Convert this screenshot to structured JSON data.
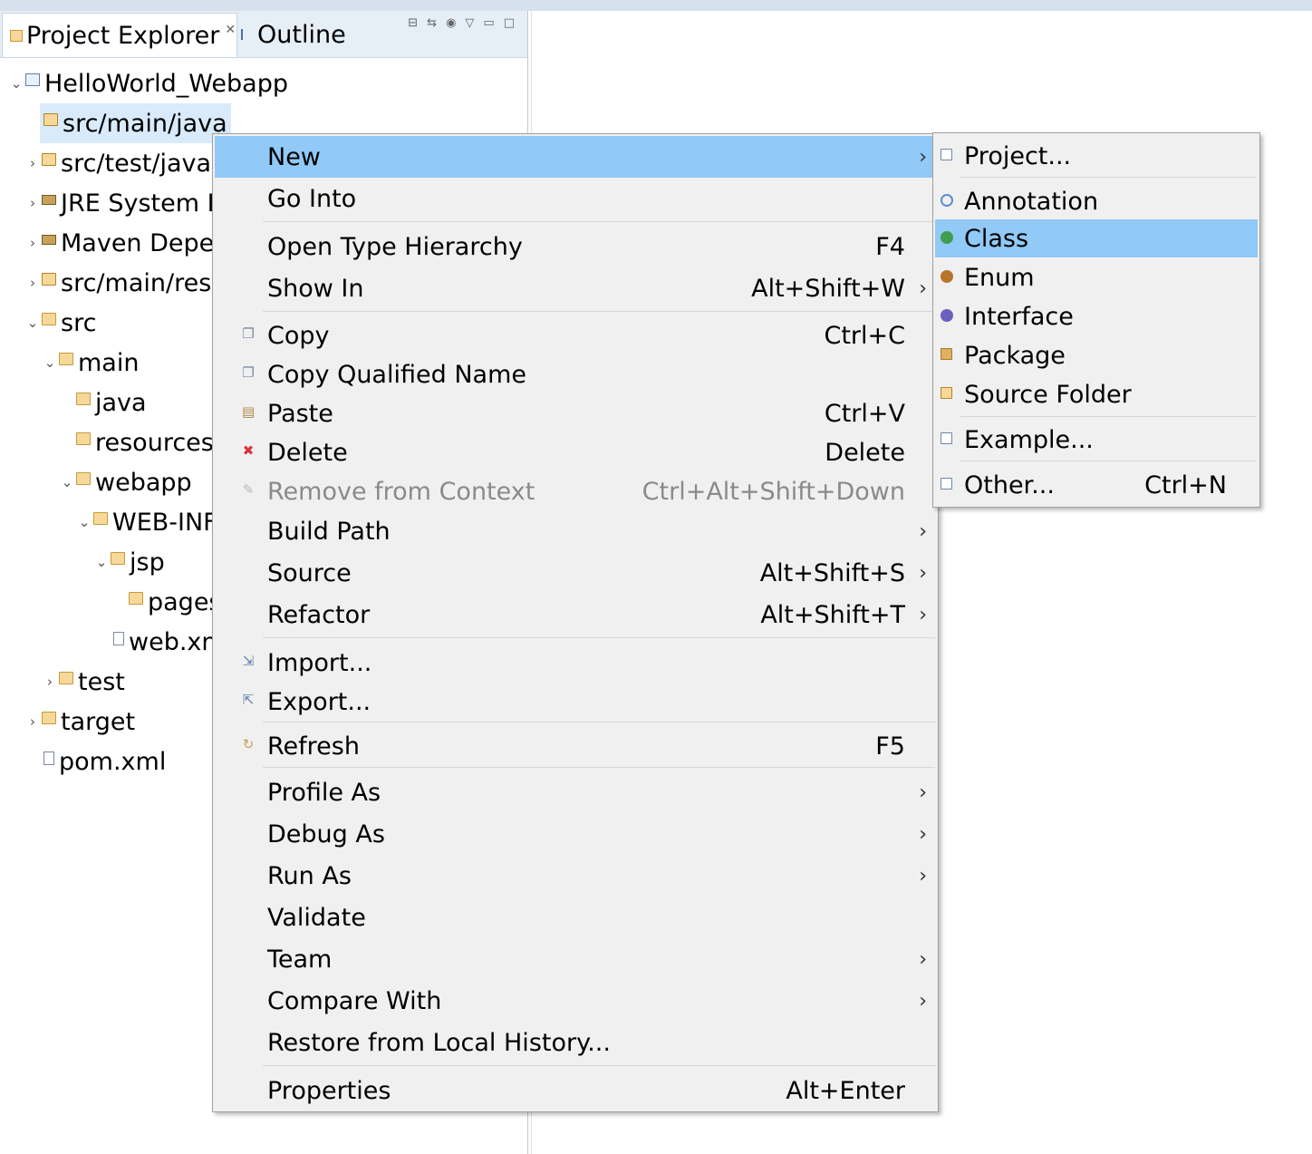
{
  "explorer": {
    "tabs": [
      {
        "label": "Project Explorer",
        "close": "✕"
      },
      {
        "label": "Outline"
      }
    ],
    "tree": [
      {
        "label": "HelloWorld_Webapp",
        "twisty": "⌄",
        "icon": "project-icon"
      },
      {
        "label": "src/main/java",
        "twisty": "",
        "icon": "source-folder-icon",
        "selected": true
      },
      {
        "label": "src/test/java",
        "twisty": "›",
        "icon": "source-folder-icon"
      },
      {
        "label": "JRE System L",
        "twisty": "›",
        "icon": "library-icon"
      },
      {
        "label": "Maven Depe",
        "twisty": "›",
        "icon": "library-icon"
      },
      {
        "label": "src/main/res",
        "twisty": "›",
        "icon": "source-folder-icon"
      },
      {
        "label": "src",
        "twisty": "⌄",
        "icon": "folder-icon"
      },
      {
        "label": "main",
        "twisty": "⌄",
        "icon": "folder-icon"
      },
      {
        "label": "java",
        "twisty": "",
        "icon": "folder-icon"
      },
      {
        "label": "resources",
        "twisty": "",
        "icon": "folder-icon"
      },
      {
        "label": "webapp",
        "twisty": "⌄",
        "icon": "folder-icon"
      },
      {
        "label": "WEB-INF",
        "twisty": "⌄",
        "icon": "folder-icon"
      },
      {
        "label": "jsp",
        "twisty": "⌄",
        "icon": "folder-icon"
      },
      {
        "label": "pages",
        "twisty": "",
        "icon": "folder-icon"
      },
      {
        "label": "web.xn",
        "twisty": "",
        "icon": "file-icon"
      },
      {
        "label": "test",
        "twisty": "›",
        "icon": "folder-icon"
      },
      {
        "label": "target",
        "twisty": "›",
        "icon": "folder-icon"
      },
      {
        "label": "pom.xml",
        "twisty": "",
        "icon": "file-icon"
      }
    ]
  },
  "context_menu": {
    "items": [
      {
        "label": "New",
        "shortcut": "",
        "submenu": true,
        "highlighted": true
      },
      {
        "label": "Go Into",
        "shortcut": ""
      },
      {
        "label": "Open Type Hierarchy",
        "shortcut": "F4"
      },
      {
        "label": "Show In",
        "shortcut": "Alt+Shift+W",
        "submenu": true
      },
      {
        "label": "Copy",
        "shortcut": "Ctrl+C",
        "icon": "copy-icon"
      },
      {
        "label": "Copy Qualified Name",
        "shortcut": "",
        "icon": "copy-qualified-icon"
      },
      {
        "label": "Paste",
        "shortcut": "Ctrl+V",
        "icon": "paste-icon"
      },
      {
        "label": "Delete",
        "shortcut": "Delete",
        "icon": "delete-icon"
      },
      {
        "label": "Remove from Context",
        "shortcut": "Ctrl+Alt+Shift+Down",
        "disabled": true,
        "icon": "remove-context-icon"
      },
      {
        "label": "Build Path",
        "shortcut": "",
        "submenu": true
      },
      {
        "label": "Source",
        "shortcut": "Alt+Shift+S",
        "submenu": true
      },
      {
        "label": "Refactor",
        "shortcut": "Alt+Shift+T",
        "submenu": true
      },
      {
        "label": "Import...",
        "shortcut": "",
        "icon": "import-icon"
      },
      {
        "label": "Export...",
        "shortcut": "",
        "icon": "export-icon"
      },
      {
        "label": "Refresh",
        "shortcut": "F5",
        "icon": "refresh-icon"
      },
      {
        "label": "Profile As",
        "shortcut": "",
        "submenu": true
      },
      {
        "label": "Debug As",
        "shortcut": "",
        "submenu": true
      },
      {
        "label": "Run As",
        "shortcut": "",
        "submenu": true
      },
      {
        "label": "Validate",
        "shortcut": ""
      },
      {
        "label": "Team",
        "shortcut": "",
        "submenu": true
      },
      {
        "label": "Compare With",
        "shortcut": "",
        "submenu": true
      },
      {
        "label": "Restore from Local History...",
        "shortcut": ""
      },
      {
        "label": "Properties",
        "shortcut": "Alt+Enter"
      }
    ]
  },
  "new_submenu": {
    "items": [
      {
        "label": "Project...",
        "shortcut": "",
        "icon": "new-project-icon"
      },
      {
        "label": "Annotation",
        "shortcut": "",
        "icon": "annotation-icon"
      },
      {
        "label": "Class",
        "shortcut": "",
        "icon": "class-icon",
        "highlighted": true
      },
      {
        "label": "Enum",
        "shortcut": "",
        "icon": "enum-icon"
      },
      {
        "label": "Interface",
        "shortcut": "",
        "icon": "interface-icon"
      },
      {
        "label": "Package",
        "shortcut": "",
        "icon": "package-icon"
      },
      {
        "label": "Source Folder",
        "shortcut": "",
        "icon": "source-folder-icon"
      },
      {
        "label": "Example...",
        "shortcut": "",
        "icon": "example-icon"
      },
      {
        "label": "Other...",
        "shortcut": "Ctrl+N",
        "icon": "other-icon"
      }
    ]
  },
  "colors": {
    "menu_bg": "#f0f0f0",
    "highlight": "#91c9f7",
    "selection": "#d9ebfb",
    "disabled_text": "#8a8a8a"
  }
}
